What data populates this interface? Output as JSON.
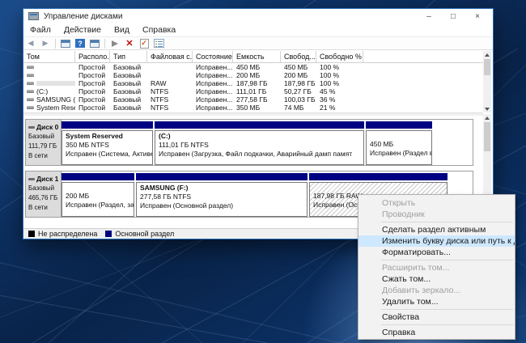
{
  "window": {
    "title": "Управление дисками"
  },
  "titlebar": {
    "minimize_glyph": "–",
    "maximize_glyph": "□",
    "close_glyph": "×"
  },
  "menubar": {
    "items": [
      "Файл",
      "Действие",
      "Вид",
      "Справка"
    ]
  },
  "toolbar": {
    "icons": [
      "back",
      "forward",
      "console-window",
      "help",
      "action-pane",
      "pointer",
      "delete-volume",
      "mark-active",
      "properties"
    ],
    "glyphs": {
      "back": "◀",
      "forward": "▶",
      "help": "?",
      "delete": "✕",
      "check": "✓"
    }
  },
  "table": {
    "headers": [
      "Том",
      "Располо...",
      "Тип",
      "Файловая с...",
      "Состояние",
      "Емкость",
      "Свобод...",
      "Свободно %"
    ],
    "rows": [
      {
        "name": "",
        "location": "Простой",
        "type": "Базовый",
        "fs": "",
        "status": "Исправен...",
        "capacity": "450 МБ",
        "free": "450 МБ",
        "free_pct": "100 %"
      },
      {
        "name": "",
        "location": "Простой",
        "type": "Базовый",
        "fs": "",
        "status": "Исправен...",
        "capacity": "200 МБ",
        "free": "200 МБ",
        "free_pct": "100 %"
      },
      {
        "name": "",
        "location": "Простой",
        "type": "Базовый",
        "fs": "RAW",
        "status": "Исправен...",
        "capacity": "187,98 ГБ",
        "free": "187,98 ГБ",
        "free_pct": "100 %"
      },
      {
        "name": "(C:)",
        "location": "Простой",
        "type": "Базовый",
        "fs": "NTFS",
        "status": "Исправен...",
        "capacity": "111,01 ГБ",
        "free": "50,27 ГБ",
        "free_pct": "45 %"
      },
      {
        "name": "SAMSUNG (F:)",
        "location": "Простой",
        "type": "Базовый",
        "fs": "NTFS",
        "status": "Исправен...",
        "capacity": "277,58 ГБ",
        "free": "100,03 ГБ",
        "free_pct": "36 %"
      },
      {
        "name": "System Reserved",
        "location": "Простой",
        "type": "Базовый",
        "fs": "NTFS",
        "status": "Исправен...",
        "capacity": "350 МБ",
        "free": "74 МБ",
        "free_pct": "21 %"
      }
    ]
  },
  "disks": [
    {
      "name": "Диск 0",
      "type": "Базовый",
      "size": "111,79 ГБ",
      "status": "В сети",
      "partitions": [
        {
          "title": "System Reserved",
          "size_line": "350 МБ NTFS",
          "status_line": "Исправен (Система, Активен,"
        },
        {
          "title": "(C:)",
          "size_line": "111,01 ГБ NTFS",
          "status_line": "Исправен (Загрузка, Файл подкачки, Аварийный дамп памят"
        },
        {
          "title": "",
          "size_line": "450 МБ",
          "status_line": "Исправен (Раздел восстановле"
        }
      ]
    },
    {
      "name": "Диск 1",
      "type": "Базовый",
      "size": "465,76 ГБ",
      "status": "В сети",
      "partitions": [
        {
          "title": "",
          "size_line": "200 МБ",
          "status_line": "Исправен (Раздел, защ"
        },
        {
          "title": "SAMSUNG (F:)",
          "size_line": "277,58 ГБ NTFS",
          "status_line": "Исправен (Основной раздел)"
        },
        {
          "title": "",
          "size_line": "187,98 ГБ RAW",
          "status_line": "Исправен (Основной раздел)",
          "selected": true
        }
      ]
    }
  ],
  "legend": {
    "items": [
      {
        "label": "Не распределена",
        "color": "#000000"
      },
      {
        "label": "Основной раздел",
        "color": "#000080"
      }
    ]
  },
  "context_menu": {
    "items": [
      {
        "label": "Открыть",
        "enabled": false
      },
      {
        "label": "Проводник",
        "enabled": false
      },
      {
        "separator": true
      },
      {
        "label": "Сделать раздел активным",
        "enabled": true
      },
      {
        "label": "Изменить букву диска или путь к диску...",
        "enabled": true,
        "highlighted": true
      },
      {
        "label": "Форматировать...",
        "enabled": true
      },
      {
        "separator": true
      },
      {
        "label": "Расширить том...",
        "enabled": false
      },
      {
        "label": "Сжать том...",
        "enabled": true
      },
      {
        "label": "Добавить зеркало...",
        "enabled": false
      },
      {
        "label": "Удалить том...",
        "enabled": true
      },
      {
        "separator": true
      },
      {
        "label": "Свойства",
        "enabled": true
      },
      {
        "separator": true
      },
      {
        "label": "Справка",
        "enabled": true
      }
    ]
  },
  "colors": {
    "partition_header": "#000082",
    "menu_highlight": "#cde8ff",
    "window_border": "#2a6cb5"
  }
}
